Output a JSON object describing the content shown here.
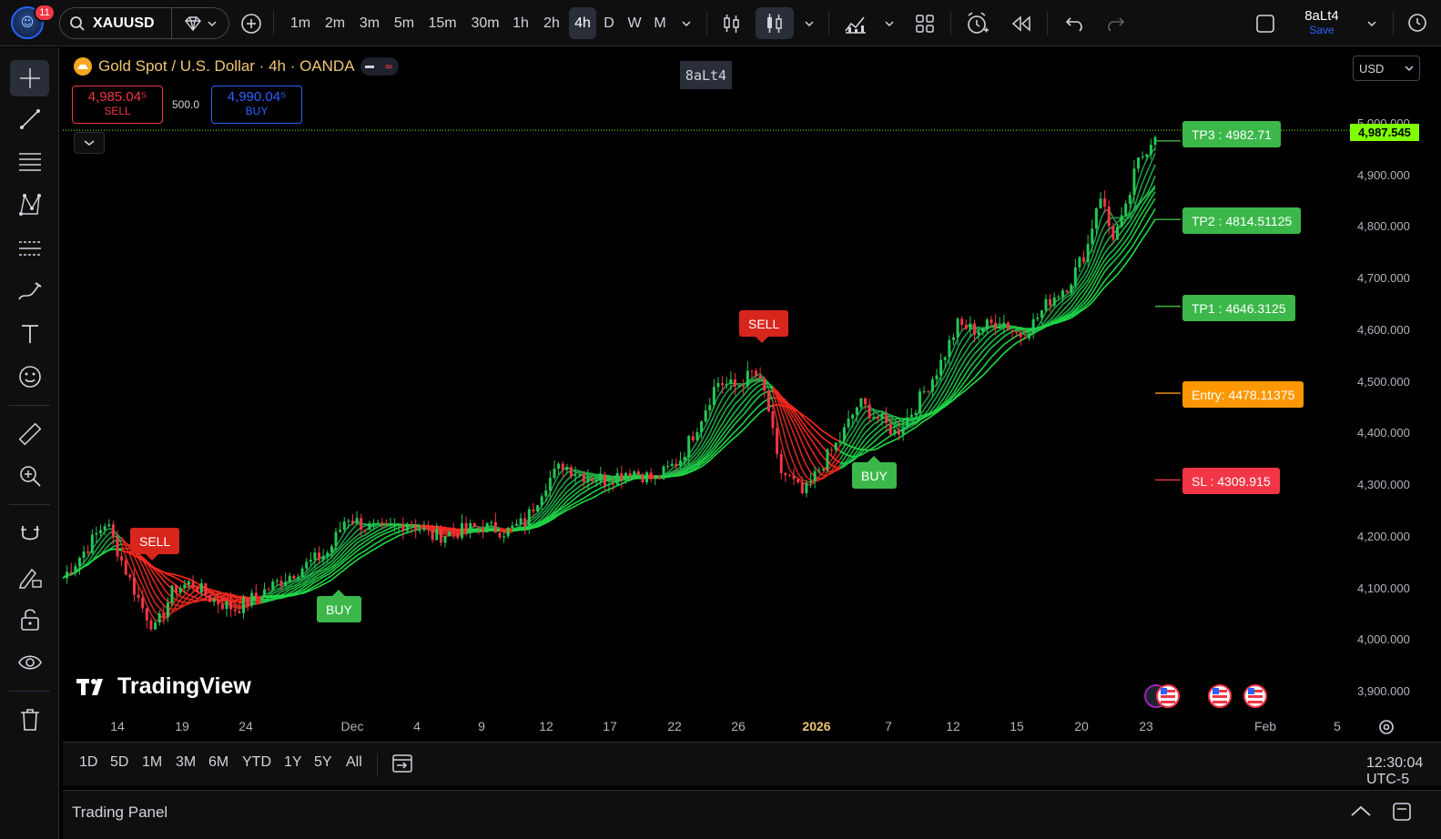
{
  "topbar": {
    "notifications": "11",
    "symbol": "XAUUSD",
    "timeframes": [
      "1m",
      "2m",
      "3m",
      "5m",
      "15m",
      "30m",
      "1h",
      "2h",
      "4h",
      "D",
      "W",
      "M"
    ],
    "active_timeframe": "4h",
    "username": "8aLt4",
    "save_label": "Save"
  },
  "legend": {
    "title": "Gold Spot / U.S. Dollar · 4h · OANDA",
    "sell_price": "4,985.04⁵",
    "sell_label": "SELL",
    "buy_price": "4,990.04⁵",
    "buy_label": "BUY",
    "spread": "500.0",
    "watermark_tag": "8aLt4"
  },
  "currency": "USD",
  "price_axis": {
    "labels": [
      "5,000.000",
      "4,900.000",
      "4,800.000",
      "4,700.000",
      "4,600.000",
      "4,500.000",
      "4,400.000",
      "4,300.000",
      "4,200.000",
      "4,100.000",
      "4,000.000",
      "3,900.000"
    ],
    "current_price": "4,987.545",
    "current_color": "#7fff00"
  },
  "time_axis": {
    "labels": [
      "14",
      "19",
      "24",
      "Dec",
      "4",
      "9",
      "12",
      "17",
      "22",
      "26",
      "2026",
      "7",
      "12",
      "15",
      "20",
      "23",
      "Feb",
      "5"
    ]
  },
  "signals": {
    "sell_1": "SELL",
    "buy_1": "BUY",
    "sell_2": "SELL",
    "buy_2": "BUY"
  },
  "targets": {
    "tp3": "TP3 : 4982.71",
    "tp2": "TP2 : 4814.51125",
    "tp1": "TP1 : 4646.3125",
    "entry": "Entry: 4478.11375",
    "sl": "SL : 4309.915"
  },
  "colors": {
    "tp": "#3cb84a",
    "entry": "#ff9800",
    "sl": "#f23645",
    "bull": "#26c653",
    "bear": "#f23645"
  },
  "watermark": "TradingView",
  "range_bar": {
    "ranges": [
      "1D",
      "5D",
      "1M",
      "3M",
      "6M",
      "YTD",
      "1Y",
      "5Y",
      "All"
    ],
    "clock": "12:30:04 UTC-5"
  },
  "trading_panel": {
    "title": "Trading Panel"
  },
  "chart_data": {
    "type": "candlestick",
    "symbol": "XAUUSD",
    "interval": "4h",
    "ylim": [
      3880,
      5030
    ],
    "x_ticks": [
      "14",
      "19",
      "24",
      "Dec",
      "4",
      "9",
      "12",
      "17",
      "22",
      "26",
      "2026",
      "7",
      "12",
      "15",
      "20",
      "23",
      "Feb",
      "5"
    ],
    "close_path": [
      [
        0,
        4120
      ],
      [
        0.02,
        4180
      ],
      [
        0.035,
        4230
      ],
      [
        0.05,
        4140
      ],
      [
        0.065,
        4060
      ],
      [
        0.075,
        4020
      ],
      [
        0.09,
        4100
      ],
      [
        0.105,
        4110
      ],
      [
        0.12,
        4080
      ],
      [
        0.14,
        4060
      ],
      [
        0.16,
        4090
      ],
      [
        0.18,
        4120
      ],
      [
        0.2,
        4150
      ],
      [
        0.215,
        4170
      ],
      [
        0.23,
        4240
      ],
      [
        0.245,
        4220
      ],
      [
        0.26,
        4210
      ],
      [
        0.28,
        4230
      ],
      [
        0.3,
        4200
      ],
      [
        0.32,
        4210
      ],
      [
        0.34,
        4220
      ],
      [
        0.36,
        4210
      ],
      [
        0.375,
        4230
      ],
      [
        0.39,
        4300
      ],
      [
        0.405,
        4340
      ],
      [
        0.42,
        4320
      ],
      [
        0.44,
        4310
      ],
      [
        0.46,
        4330
      ],
      [
        0.48,
        4310
      ],
      [
        0.5,
        4350
      ],
      [
        0.515,
        4420
      ],
      [
        0.53,
        4500
      ],
      [
        0.545,
        4490
      ],
      [
        0.56,
        4520
      ],
      [
        0.57,
        4470
      ],
      [
        0.58,
        4330
      ],
      [
        0.59,
        4310
      ],
      [
        0.6,
        4280
      ],
      [
        0.615,
        4340
      ],
      [
        0.63,
        4390
      ],
      [
        0.645,
        4460
      ],
      [
        0.66,
        4430
      ],
      [
        0.675,
        4400
      ],
      [
        0.69,
        4450
      ],
      [
        0.71,
        4530
      ],
      [
        0.725,
        4610
      ],
      [
        0.74,
        4600
      ],
      [
        0.76,
        4620
      ],
      [
        0.775,
        4590
      ],
      [
        0.785,
        4610
      ],
      [
        0.8,
        4660
      ],
      [
        0.815,
        4690
      ],
      [
        0.83,
        4760
      ],
      [
        0.84,
        4870
      ],
      [
        0.85,
        4780
      ],
      [
        0.86,
        4820
      ],
      [
        0.87,
        4920
      ],
      [
        0.88,
        4960
      ],
      [
        0.885,
        4985
      ]
    ],
    "signals": [
      {
        "type": "SELL",
        "at": 0.055
      },
      {
        "type": "BUY",
        "at": 0.21
      },
      {
        "type": "SELL",
        "at": 0.56
      },
      {
        "type": "BUY",
        "at": 0.64
      }
    ],
    "levels": [
      {
        "name": "TP3",
        "value": 4982.71
      },
      {
        "name": "TP2",
        "value": 4814.51125
      },
      {
        "name": "TP1",
        "value": 4646.3125
      },
      {
        "name": "Entry",
        "value": 4478.11375
      },
      {
        "name": "SL",
        "value": 4309.915
      }
    ],
    "current_price": 4987.545
  }
}
